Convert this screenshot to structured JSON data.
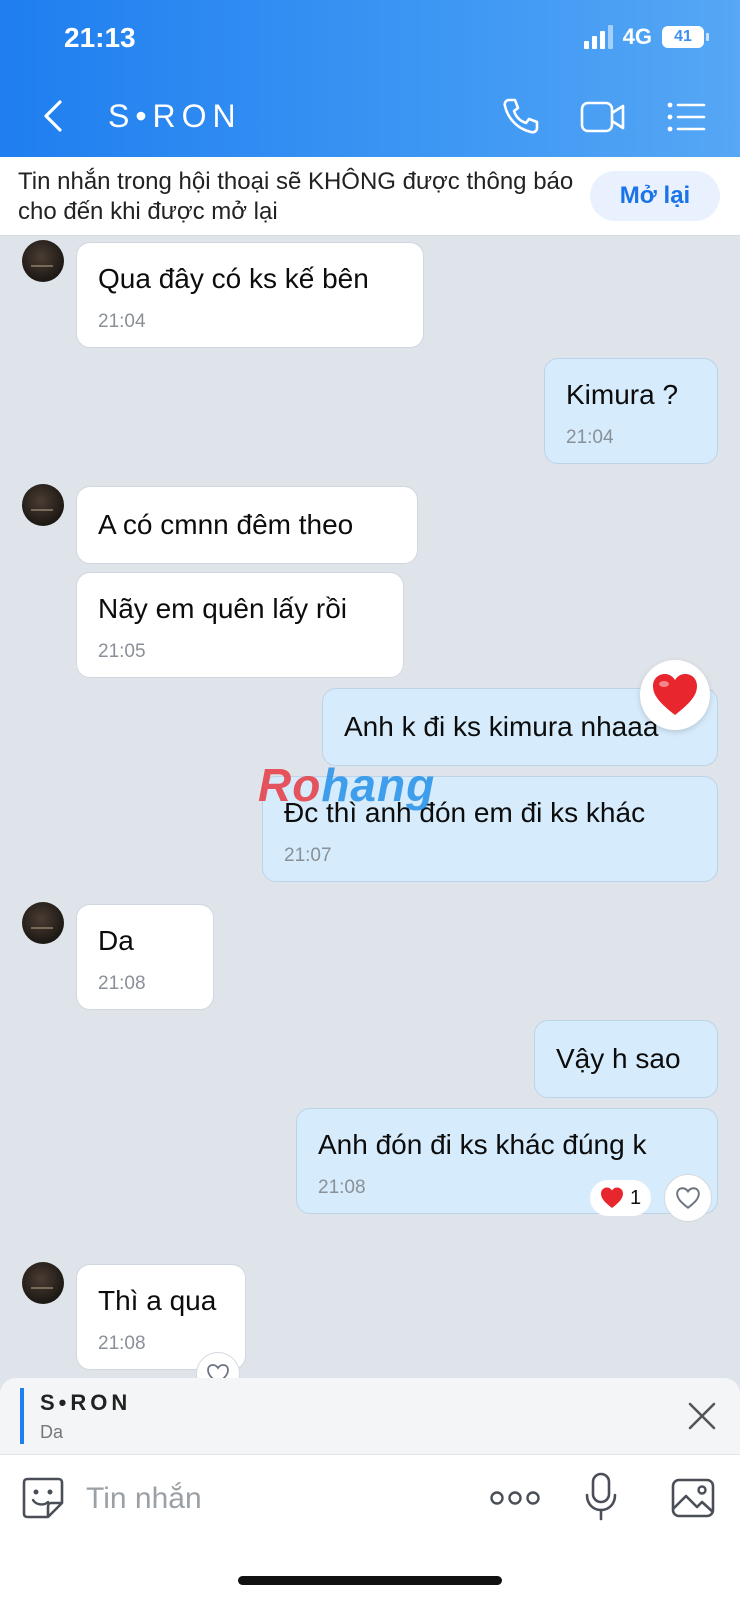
{
  "status_bar": {
    "time": "21:13",
    "network": "4G",
    "battery": "41"
  },
  "header": {
    "title": "S•RON"
  },
  "notice": {
    "text": "Tin nhắn trong hội thoại sẽ KHÔNG được thông báo cho đến khi được mở lại",
    "button": "Mở lại"
  },
  "messages": [
    {
      "dir": "in",
      "text": "Qua đây có ks kế bên",
      "time": "21:04"
    },
    {
      "dir": "out",
      "text": "Kimura ?",
      "time": "21:04"
    },
    {
      "dir": "in",
      "text": "A có cmnn đêm theo",
      "time": ""
    },
    {
      "dir": "in",
      "text": "Nãy em quên lấy rồi",
      "time": "21:05"
    },
    {
      "dir": "out",
      "text": "Anh k đi ks kimura nhaaa",
      "time": ""
    },
    {
      "dir": "out",
      "text": "Đc thì anh đón em đi ks khác",
      "time": "21:07"
    },
    {
      "dir": "in",
      "text": "Da",
      "time": "21:08"
    },
    {
      "dir": "out",
      "text": "Vậy h sao",
      "time": ""
    },
    {
      "dir": "out",
      "text": "Anh đón đi ks khác đúng k",
      "time": "21:08"
    },
    {
      "dir": "in",
      "text": "Thì a qua",
      "time": "21:08"
    }
  ],
  "reactions": {
    "heart_count": "1"
  },
  "watermark": {
    "part1": "Ro",
    "part2": "hang"
  },
  "reply_preview": {
    "name": "S•RON",
    "text": "Da"
  },
  "composer": {
    "placeholder": "Tin nhắn"
  },
  "colors": {
    "header": "#1f7ef0",
    "outgoing_bubble": "#d6ebfb",
    "incoming_bubble": "#ffffff",
    "accent": "#1b73e8"
  }
}
